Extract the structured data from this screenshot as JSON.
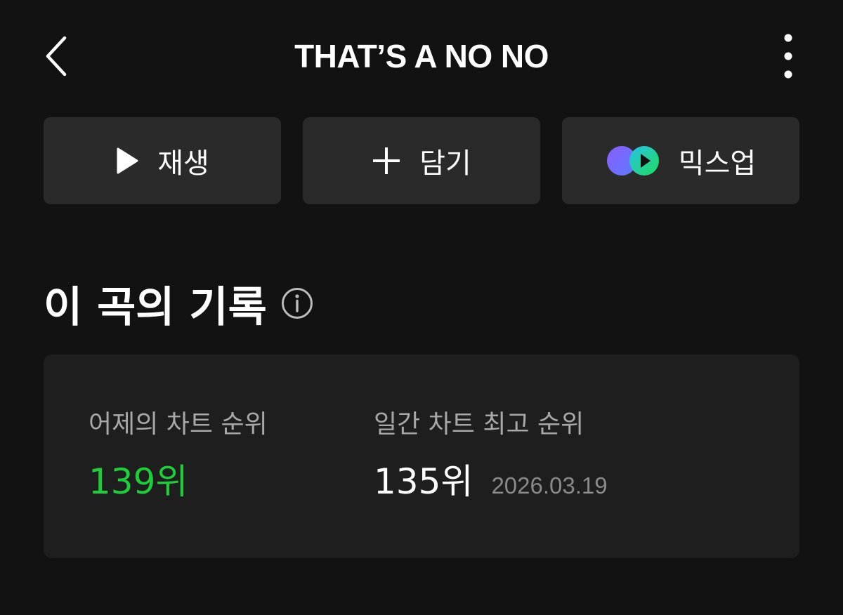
{
  "header": {
    "title": "THAT’S A NO NO",
    "back_icon": "chevron-left-icon",
    "more_icon": "more-vertical-icon"
  },
  "actions": {
    "play": {
      "label": "재생",
      "icon": "play-icon"
    },
    "add": {
      "label": "담기",
      "icon": "plus-icon"
    },
    "mixup": {
      "label": "믹스업",
      "icon": "mixup-logo-icon"
    }
  },
  "section": {
    "title": "이 곡의 기록",
    "info_icon": "info-icon"
  },
  "stats": {
    "yesterday": {
      "label": "어제의 차트 순위",
      "value": "139위"
    },
    "best": {
      "label": "일간 차트 최고 순위",
      "value": "135위",
      "date": "2026.03.19"
    }
  },
  "colors": {
    "background": "#121212",
    "button_bg": "#2a2a2a",
    "card_bg": "#1e1e1e",
    "accent_green": "#1fcd3a",
    "mixup_purple": "#7b5cff",
    "mixup_cyan": "#27c2e8",
    "mixup_green": "#1fdc5a"
  }
}
